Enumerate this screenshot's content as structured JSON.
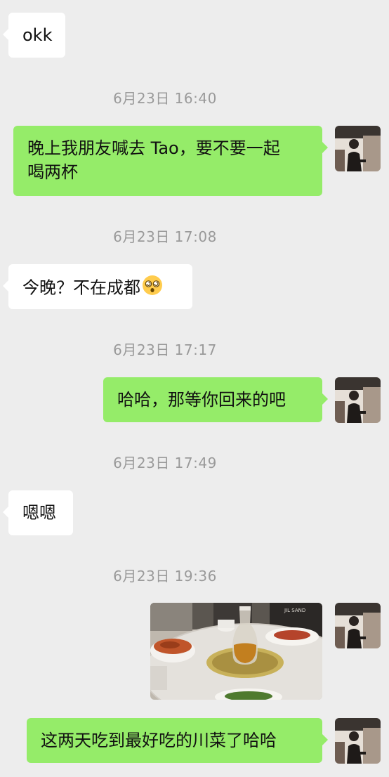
{
  "messages": [
    {
      "side": "in",
      "text": "okk"
    },
    {
      "timestamp": "6月23日 16:40"
    },
    {
      "side": "out",
      "line1": "晚上我朋友喊去 Tao，要不要一起",
      "line2": "喝两杯"
    },
    {
      "timestamp": "6月23日 17:08"
    },
    {
      "side": "in",
      "text": "今晚？不在成都",
      "emoji": "dizzy-face-emoji"
    },
    {
      "timestamp": "6月23日 17:17"
    },
    {
      "side": "out",
      "text": "哈哈，那等你回来的吧"
    },
    {
      "timestamp": "6月23日 17:49"
    },
    {
      "side": "in",
      "text": "嗯嗯"
    },
    {
      "timestamp": "6月23日 19:36"
    },
    {
      "side": "out",
      "image": "restaurant-table-photo",
      "image_text": "JIL SAND"
    },
    {
      "side": "out",
      "text": "这两天吃到最好吃的川菜了哈哈"
    }
  ],
  "colors": {
    "background": "#ededed",
    "incoming_bubble": "#ffffff",
    "outgoing_bubble": "#95ec69",
    "timestamp_text": "#9a9a9a"
  }
}
